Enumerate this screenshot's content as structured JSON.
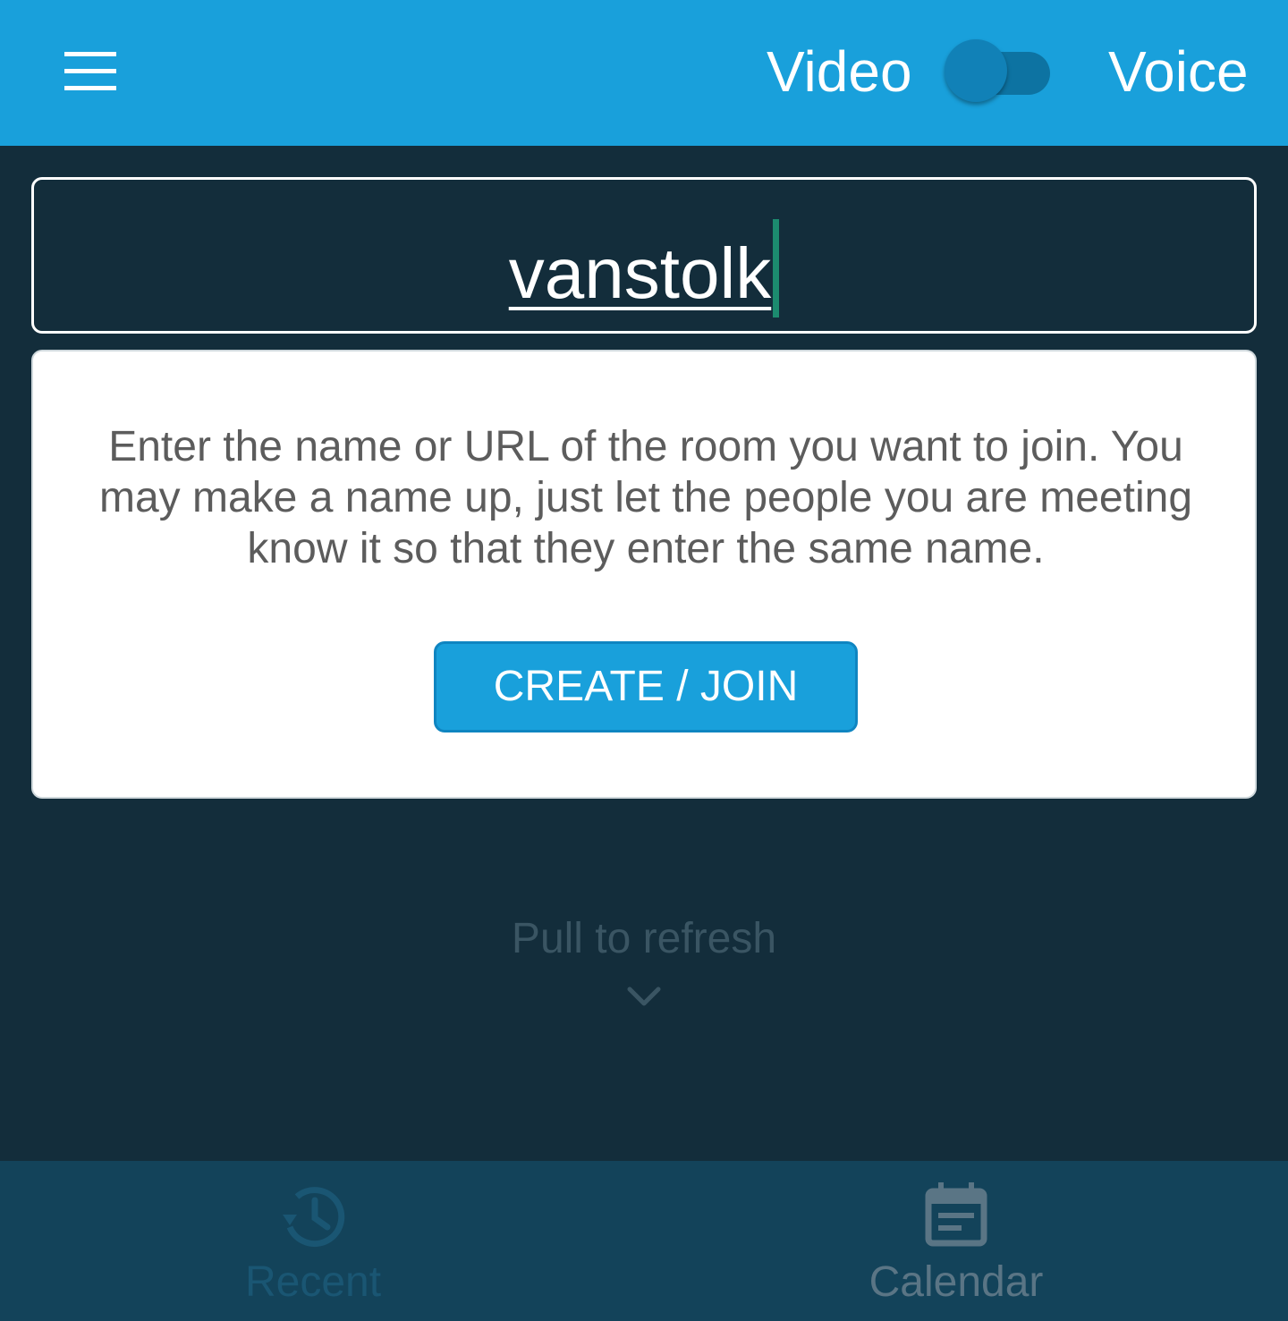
{
  "header": {
    "mode_left_label": "Video",
    "mode_right_label": "Voice",
    "toggle_state": "off"
  },
  "room": {
    "value": "vanstolk"
  },
  "card": {
    "description": "Enter the name or URL of the room you want to join. You may make a name up, just let the people you are meeting know it so that they enter the same name.",
    "button_label": "CREATE / JOIN"
  },
  "pull": {
    "label": "Pull to refresh"
  },
  "bottom_nav": {
    "items": [
      {
        "label": "Recent",
        "icon": "history-icon",
        "active": false
      },
      {
        "label": "Calendar",
        "icon": "calendar-icon",
        "active": true
      }
    ]
  },
  "colors": {
    "brand_blue": "#19a0db",
    "background": "#132d3b",
    "bottom_bar": "#13435a",
    "cursor": "#1c8b6f"
  }
}
